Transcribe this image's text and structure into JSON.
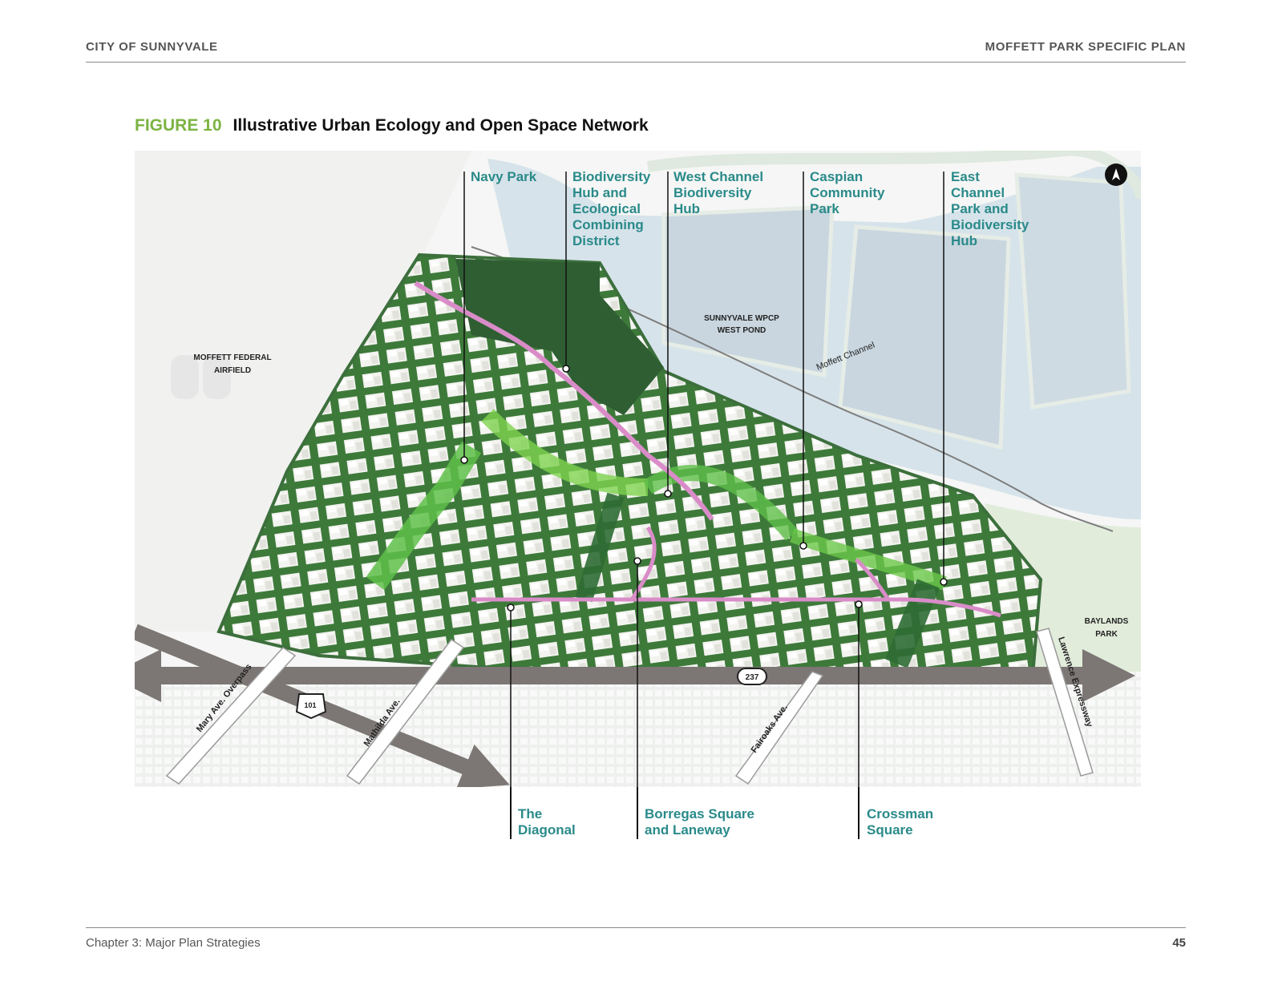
{
  "header": {
    "left": "CITY OF SUNNYVALE",
    "right": "MOFFETT PARK SPECIFIC PLAN"
  },
  "figure": {
    "number": "FIGURE 10",
    "title": "Illustrative Urban Ecology and Open Space Network"
  },
  "map_labels": {
    "airfield": [
      "MOFFETT FEDERAL",
      "AIRFIELD"
    ],
    "west_pond": [
      "SUNNYVALE WPCP",
      "WEST POND"
    ],
    "channel": "Moffett Channel",
    "baylands": [
      "BAYLANDS",
      "PARK"
    ],
    "mary": "Mary Ave. Overpass",
    "mathilda": "Mathilda Ave.",
    "fairoaks": "Fairoaks Ave.",
    "lawrence": "Lawrence Expressway",
    "hwy101": "101",
    "hwy237": "237",
    "north_icon": "north-arrow-icon"
  },
  "callouts_top": [
    {
      "lines": [
        "Navy Park"
      ]
    },
    {
      "lines": [
        "Biodiversity",
        "Hub and",
        "Ecological",
        "Combining",
        "District"
      ]
    },
    {
      "lines": [
        "West Channel",
        "Biodiversity",
        "Hub"
      ]
    },
    {
      "lines": [
        "Caspian",
        "Community",
        "Park"
      ]
    },
    {
      "lines": [
        "East",
        "Channel",
        "Park and",
        "Biodiversity",
        "Hub"
      ]
    }
  ],
  "callouts_bottom": [
    {
      "lines": [
        "The",
        "Diagonal"
      ]
    },
    {
      "lines": [
        "Borregas Square",
        "and Laneway"
      ]
    },
    {
      "lines": [
        "Crossman",
        "Square"
      ]
    }
  ],
  "colors": {
    "accent_green": "#7cb342",
    "callout_teal": "#2a8a8a",
    "pink_path": "#d98cc8",
    "dark_green": "#2e6b34"
  },
  "footer": {
    "chapter": "Chapter 3: Major Plan Strategies",
    "page": "45"
  }
}
